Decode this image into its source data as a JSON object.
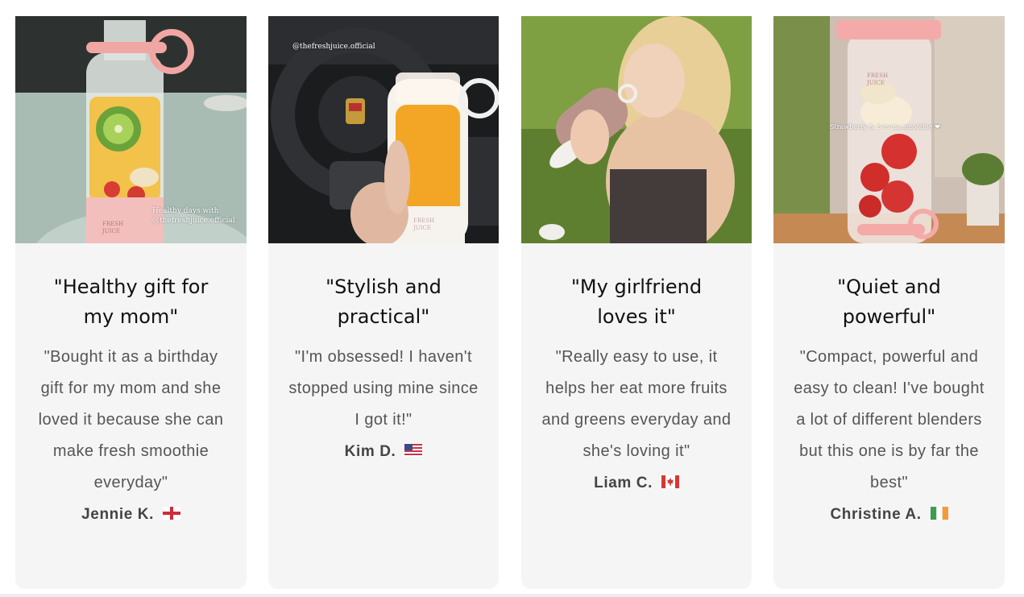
{
  "reviews": [
    {
      "headline": "\"Healthy gift for my mom\"",
      "quote": "\"Bought it as a birthday gift for my mom and she loved it because she can make fresh smoothie everyday\"",
      "author": "Jennie K.",
      "flag": "england-flag-icon",
      "photo_overlay": "Healthy days with @thefreshjuice.official",
      "bottle_label": "FRESH JUICE"
    },
    {
      "headline": "\"Stylish and practical\"",
      "quote": "\"I'm obsessed! I haven't stopped using mine since I got it!\"",
      "author": "Kim D.",
      "flag": "usa-flag-icon",
      "photo_overlay": "@thefreshjuice.official",
      "bottle_label": "FRESH JUICE"
    },
    {
      "headline": "\"My girlfriend loves it\"",
      "quote": "\"Really easy to use, it helps her eat more fruits and greens everyday and she's loving it\"",
      "author": "Liam C.",
      "flag": "canada-flag-icon",
      "photo_overlay": "",
      "bottle_label": ""
    },
    {
      "headline": "\"Quiet and powerful\"",
      "quote": "\"Compact, powerful and easy to clean! I've bought a lot of different blenders but this one is by far the best\"",
      "author": "Christine A.",
      "flag": "ireland-flag-icon",
      "photo_overlay": "Strawberry & banana smoothie ❤",
      "bottle_label": "FRESH JUICE"
    }
  ],
  "colors": {
    "card_bg": "#f5f5f5",
    "headline": "#111111",
    "quote": "#555555",
    "author": "#444444",
    "bottle_pink": "#f2a7a4"
  }
}
